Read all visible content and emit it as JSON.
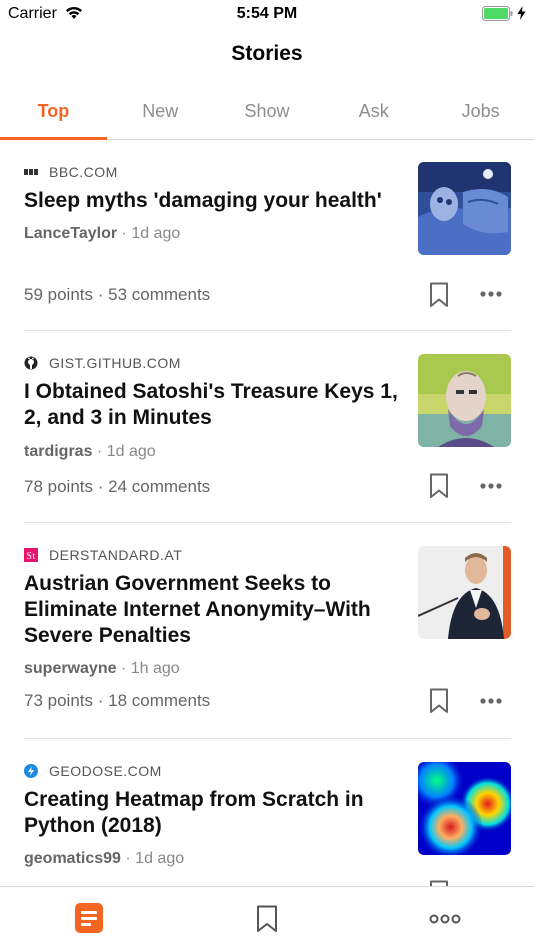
{
  "status_bar": {
    "carrier": "Carrier",
    "time": "5:54 PM",
    "battery_color": "#4cd964"
  },
  "nav": {
    "title": "Stories"
  },
  "tabs": [
    {
      "label": "Top",
      "active": true
    },
    {
      "label": "New",
      "active": false
    },
    {
      "label": "Show",
      "active": false
    },
    {
      "label": "Ask",
      "active": false
    },
    {
      "label": "Jobs",
      "active": false
    }
  ],
  "accent_color": "#f26522",
  "stories": [
    {
      "source": "BBC.COM",
      "favicon": "bbc-icon",
      "title": "Sleep myths 'damaging your health'",
      "author": "LanceTaylor",
      "age": "1d ago",
      "points": "59 points",
      "comments": "53 comments",
      "thumbnail": "sleeping-person-illustration"
    },
    {
      "source": "GIST.GITHUB.COM",
      "favicon": "github-icon",
      "title": "I Obtained Satoshi's Treasure Keys 1, 2, and 3 in Minutes",
      "author": "tardigras",
      "age": "1d ago",
      "points": "78 points",
      "comments": "24 comments",
      "thumbnail": "bearded-man-portrait"
    },
    {
      "source": "DERSTANDARD.AT",
      "favicon": "derstandard-icon",
      "title": "Austrian Government Seeks to Eliminate Internet Anonymity–With Severe Penalties",
      "author": "superwayne",
      "age": "1h ago",
      "points": "73 points",
      "comments": "18 comments",
      "thumbnail": "politician-speaking-photo"
    },
    {
      "source": "GEODOSE.COM",
      "favicon": "geodose-icon",
      "title": "Creating Heatmap from Scratch in Python (2018)",
      "author": "geomatics99",
      "age": "1d ago",
      "points": "",
      "comments": "",
      "thumbnail": "heatmap-image"
    }
  ],
  "tabbar": {
    "items": [
      {
        "name": "stories-tab-icon",
        "active": true
      },
      {
        "name": "bookmarks-tab-icon",
        "active": false
      },
      {
        "name": "more-tab-icon",
        "active": false
      }
    ]
  }
}
